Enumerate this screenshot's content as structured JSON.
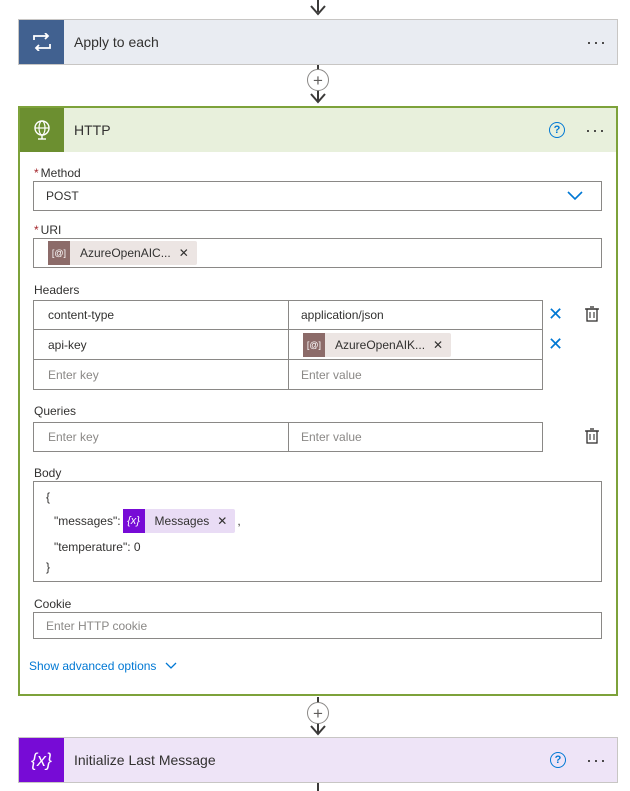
{
  "apply_card": {
    "title": "Apply to each",
    "icon": "loop-icon",
    "more": "···",
    "color": "#416190"
  },
  "http_card": {
    "title": "HTTP",
    "icon": "globe-icon",
    "more": "···",
    "help": "?",
    "method": {
      "label": "Method",
      "value": "POST"
    },
    "uri": {
      "label": "URI",
      "token": "AzureOpenAIC..."
    },
    "headers": {
      "label": "Headers",
      "rows": [
        {
          "key": "content-type",
          "value": "application/json"
        },
        {
          "key": "api-key",
          "token": "AzureOpenAIK..."
        }
      ],
      "key_placeholder": "Enter key",
      "value_placeholder": "Enter value"
    },
    "queries": {
      "label": "Queries",
      "key_placeholder": "Enter key",
      "value_placeholder": "Enter value"
    },
    "body": {
      "label": "Body",
      "line1": "{",
      "line2_prefix": "\"messages\":",
      "line2_token": "Messages",
      "line2_suffix": ",",
      "line3": "\"temperature\": 0",
      "line4": "}"
    },
    "cookie": {
      "label": "Cookie",
      "placeholder": "Enter HTTP cookie"
    },
    "advanced": "Show advanced options",
    "color": "#6c8f30"
  },
  "init_card": {
    "title": "Initialize Last Message",
    "icon": "variable-icon",
    "icon_text": "{x}",
    "help": "?",
    "more": "···",
    "color": "#770bd6"
  },
  "connector_plus": "+"
}
